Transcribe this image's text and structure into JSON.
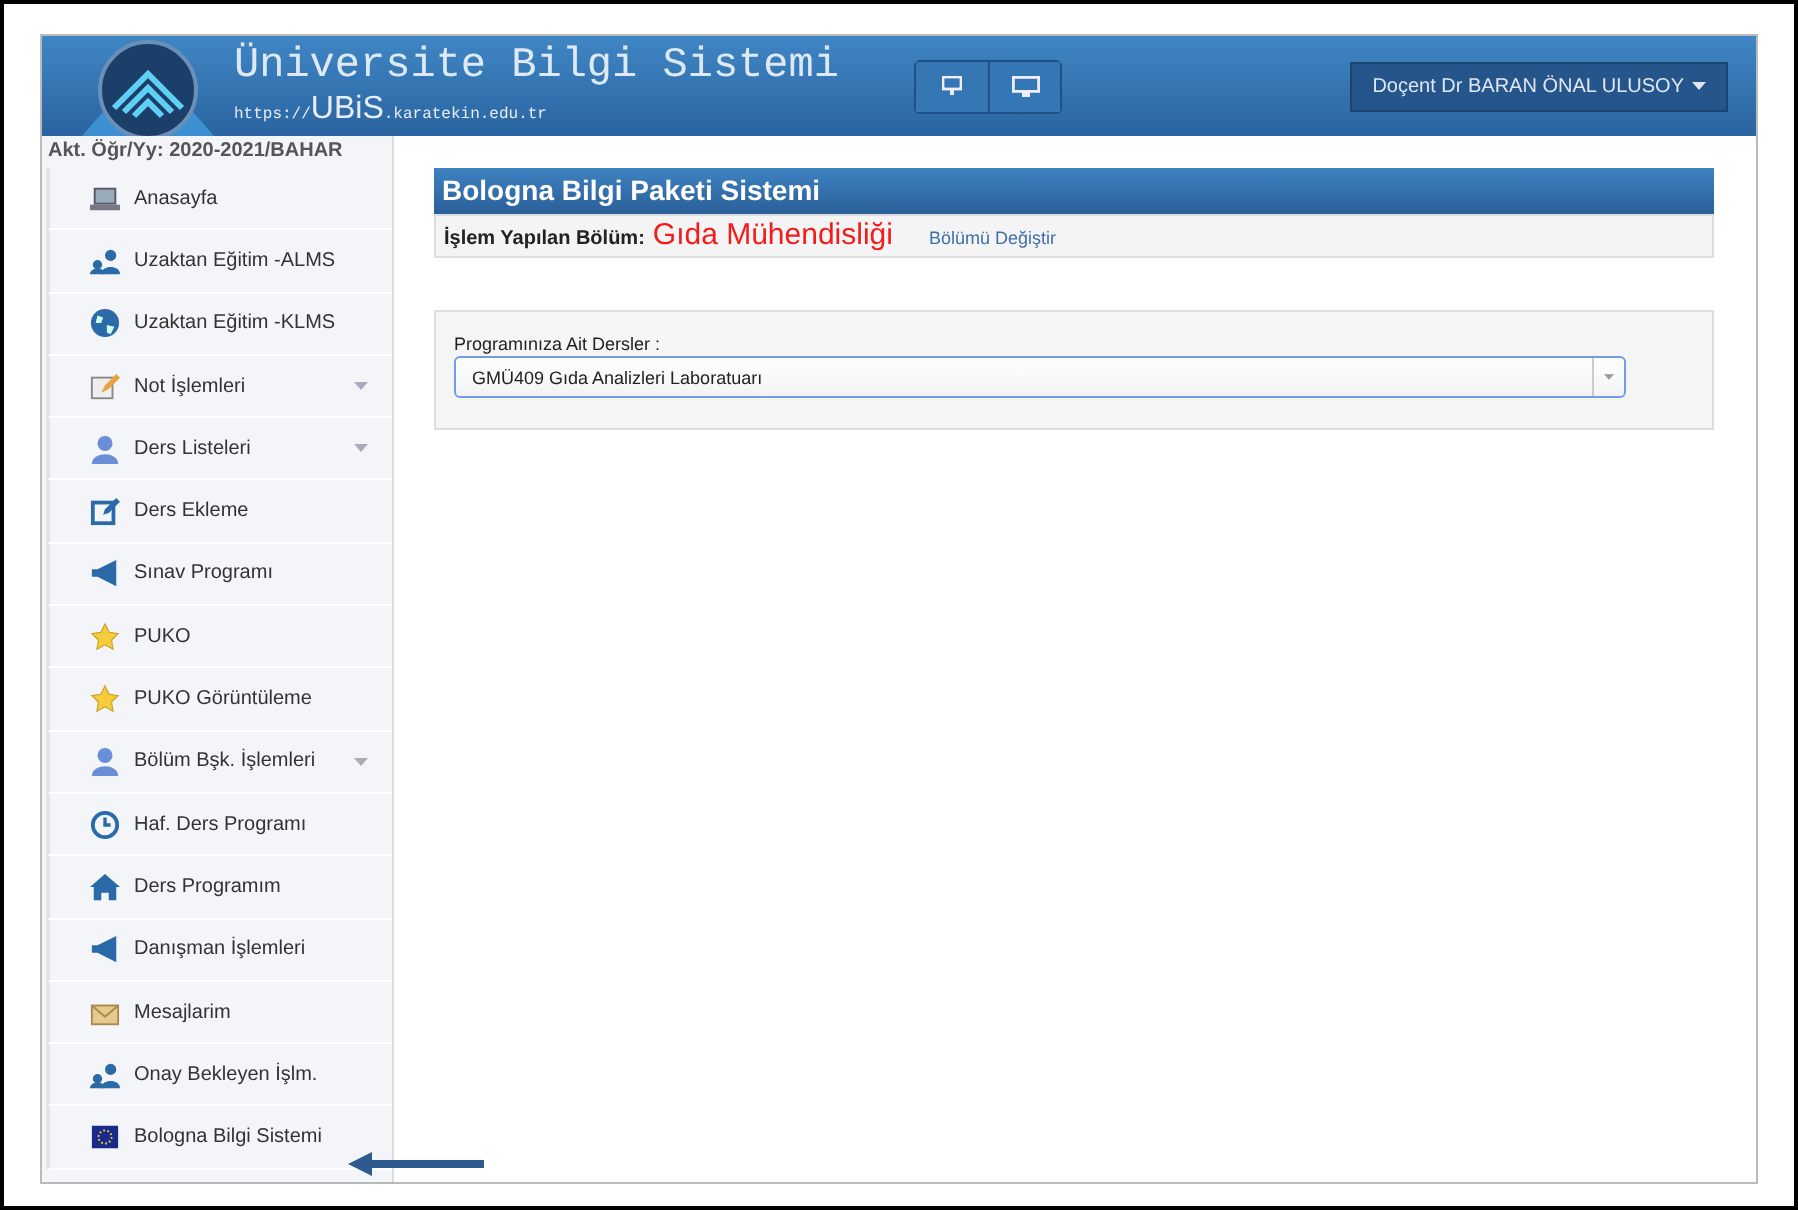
{
  "header": {
    "title": "Üniversite Bilgi Sistemi",
    "url_prefix": "https://",
    "brand": "UBiS",
    "url_suffix": ".karatekin.edu.tr",
    "user_menu": "Doçent Dr BARAN ÖNAL ULUSOY"
  },
  "sidebar": {
    "term": "Akt. Öğr/Yy: 2020-2021/BAHAR",
    "items": [
      {
        "label": "Anasayfa",
        "kind": "laptop",
        "expandable": false
      },
      {
        "label": "Uzaktan Eğitim -ALMS",
        "kind": "users",
        "expandable": false
      },
      {
        "label": "Uzaktan Eğitim -KLMS",
        "kind": "globe",
        "expandable": false
      },
      {
        "label": "Not İşlemleri",
        "kind": "pencil",
        "expandable": true
      },
      {
        "label": "Ders Listeleri",
        "kind": "user",
        "expandable": true
      },
      {
        "label": "Ders Ekleme",
        "kind": "edit",
        "expandable": false
      },
      {
        "label": "Sınav Programı",
        "kind": "megaphone",
        "expandable": false
      },
      {
        "label": "PUKO",
        "kind": "star",
        "expandable": false
      },
      {
        "label": "PUKO Görüntüleme",
        "kind": "star",
        "expandable": false
      },
      {
        "label": "Bölüm Bşk. İşlemleri",
        "kind": "user",
        "expandable": true
      },
      {
        "label": "Haf. Ders Programı",
        "kind": "clock",
        "expandable": false
      },
      {
        "label": "Ders Programım",
        "kind": "home",
        "expandable": false
      },
      {
        "label": "Danışman İşlemleri",
        "kind": "megaphone",
        "expandable": false
      },
      {
        "label": "Mesajlarim",
        "kind": "envelope",
        "expandable": false
      },
      {
        "label": "Onay Bekleyen İşlm.",
        "kind": "users",
        "expandable": false
      },
      {
        "label": "Bologna Bilgi Sistemi",
        "kind": "flag",
        "expandable": false
      }
    ]
  },
  "panel": {
    "title": "Bologna Bilgi Paketi Sistemi",
    "department_label": "İşlem Yapılan Bölüm:",
    "department": "Gıda Mühendisliği",
    "change_link": "Bölümü Değiştir",
    "courses_label": "Programınıza Ait Dersler :",
    "course_select": "GMÜ409 Gıda Analizleri Laboratuarı"
  }
}
